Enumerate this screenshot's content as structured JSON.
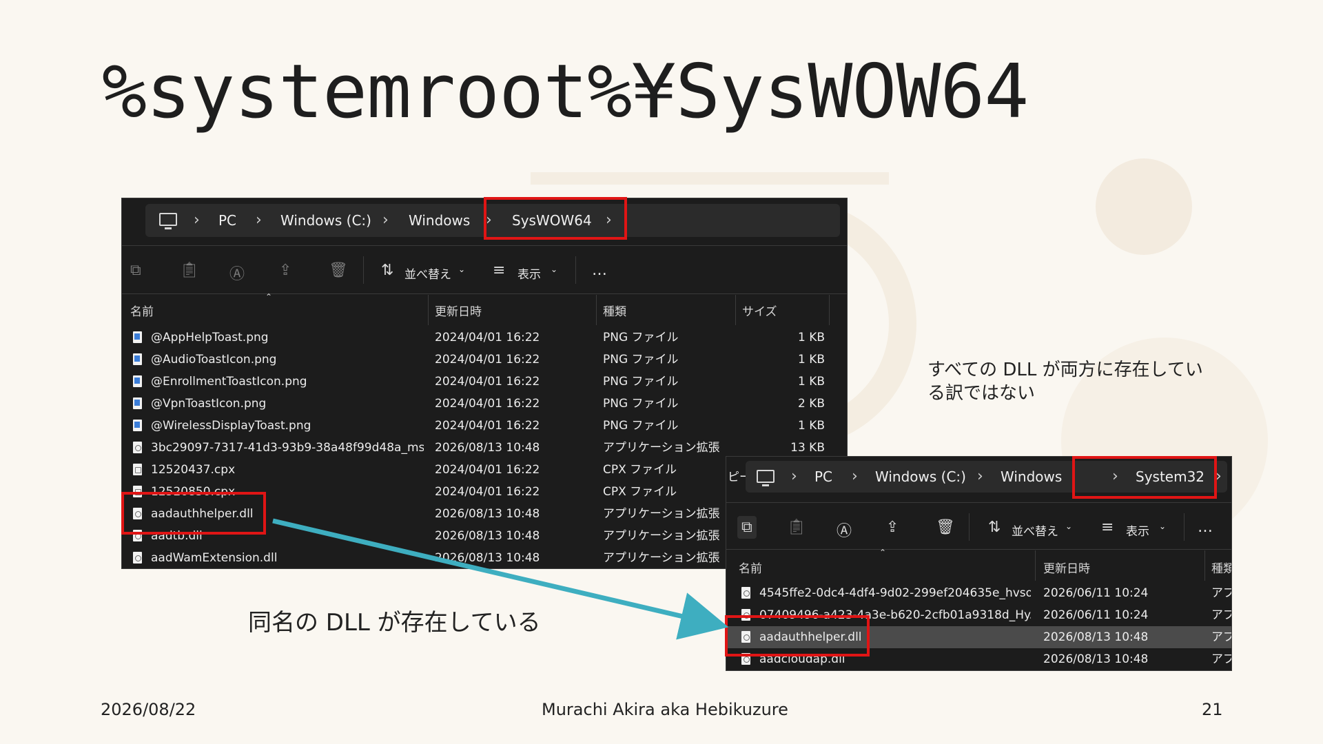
{
  "slide": {
    "title": "%systemroot%¥SysWOW64",
    "note_right": "すべての DLL が両方に存在している訳ではない",
    "note_center": "同名の DLL が存在している",
    "footer_date": "2026/08/22",
    "footer_author": "Murachi Akira aka Hebikuzure",
    "page_number": "21"
  },
  "window1": {
    "breadcrumb": [
      "PC",
      "Windows (C:)",
      "Windows",
      "SysWOW64"
    ],
    "toolbar": {
      "sort_label": "並べ替え",
      "view_label": "表示",
      "more_label": "…"
    },
    "columns": [
      "名前",
      "更新日時",
      "種類",
      "サイズ"
    ],
    "rows": [
      {
        "name": "@AppHelpToast.png",
        "date": "2024/04/01 16:22",
        "type": "PNG ファイル",
        "size": "1 KB",
        "icon": "png"
      },
      {
        "name": "@AudioToastIcon.png",
        "date": "2024/04/01 16:22",
        "type": "PNG ファイル",
        "size": "1 KB",
        "icon": "png"
      },
      {
        "name": "@EnrollmentToastIcon.png",
        "date": "2024/04/01 16:22",
        "type": "PNG ファイル",
        "size": "1 KB",
        "icon": "png"
      },
      {
        "name": "@VpnToastIcon.png",
        "date": "2024/04/01 16:22",
        "type": "PNG ファイル",
        "size": "2 KB",
        "icon": "png"
      },
      {
        "name": "@WirelessDisplayToast.png",
        "date": "2024/04/01 16:22",
        "type": "PNG ファイル",
        "size": "1 KB",
        "icon": "png"
      },
      {
        "name": "3bc29097-7317-41d3-93b9-38a48f99d48a_ms...",
        "date": "2026/08/13 10:48",
        "type": "アプリケーション拡張",
        "size": "13 KB",
        "icon": "dll"
      },
      {
        "name": "12520437.cpx",
        "date": "2024/04/01 16:22",
        "type": "CPX ファイル",
        "size": "",
        "icon": "app"
      },
      {
        "name": "12520850.cpx",
        "date": "2024/04/01 16:22",
        "type": "CPX ファイル",
        "size": "",
        "icon": "app"
      },
      {
        "name": "aadauthhelper.dll",
        "date": "2026/08/13 10:48",
        "type": "アプリケーション拡張",
        "size": "",
        "icon": "dll"
      },
      {
        "name": "aadtb.dll",
        "date": "2026/08/13 10:48",
        "type": "アプリケーション拡張",
        "size": "",
        "icon": "dll"
      },
      {
        "name": "aadWamExtension.dll",
        "date": "2026/08/13 10:48",
        "type": "アプリケーション拡張",
        "size": "",
        "icon": "dll"
      }
    ]
  },
  "window2": {
    "left_clip_text": "ピー",
    "breadcrumb": [
      "PC",
      "Windows (C:)",
      "Windows",
      "System32"
    ],
    "toolbar": {
      "sort_label": "並べ替え",
      "view_label": "表示",
      "more_label": "…"
    },
    "columns": [
      "名前",
      "更新日時",
      "種類"
    ],
    "rows": [
      {
        "name": "4545ffe2-0dc4-4df4-9d02-299ef204635e_hvso...",
        "date": "2026/06/11 10:24",
        "type": "アプ",
        "icon": "dll"
      },
      {
        "name": "07409496-a423-4a3e-b620-2cfb01a9318d_Hy...",
        "date": "2026/06/11 10:24",
        "type": "アプ",
        "icon": "dll"
      },
      {
        "name": "aadauthhelper.dll",
        "date": "2026/08/13 10:48",
        "type": "アプ",
        "icon": "dll",
        "selected": true
      },
      {
        "name": "aadcloudap.dll",
        "date": "2026/08/13 10:48",
        "type": "アプ",
        "icon": "dll"
      }
    ]
  },
  "colors": {
    "highlight": "#e01515",
    "arrow": "#3eaec0",
    "window_bg": "#1c1c1c"
  }
}
